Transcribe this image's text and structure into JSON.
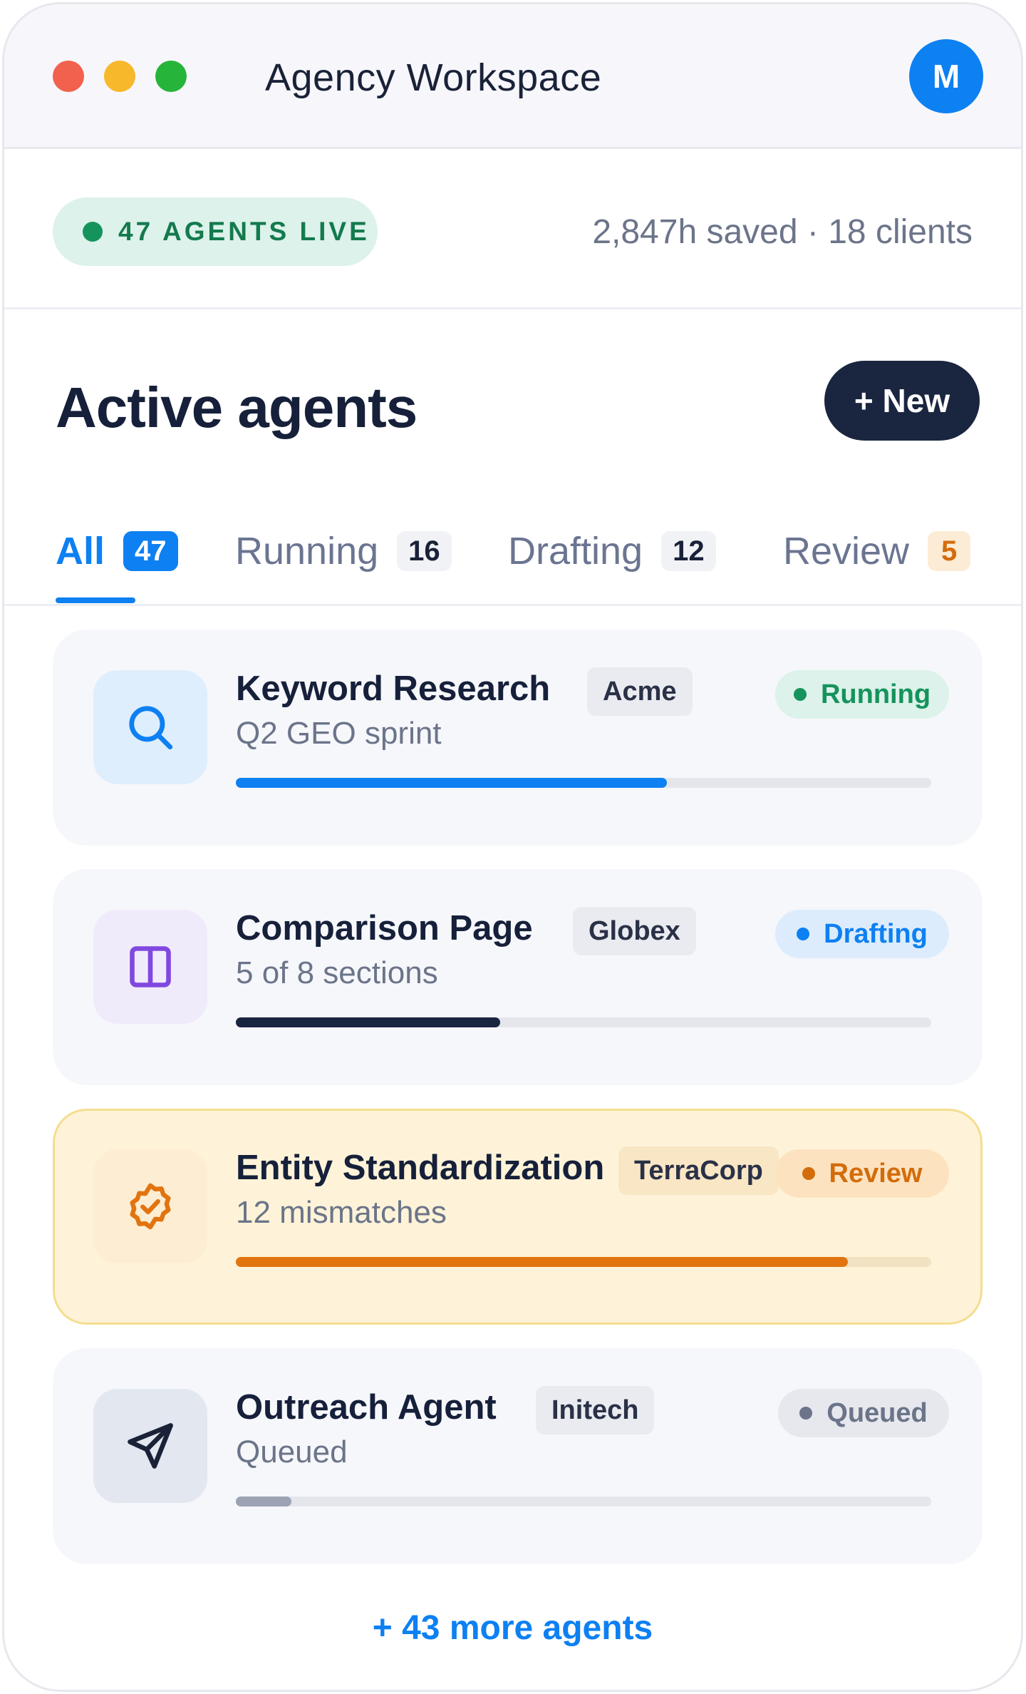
{
  "window": {
    "title": "Agency Workspace",
    "avatar_initial": "M"
  },
  "stats": {
    "live_label": "47 AGENTS LIVE",
    "summary": "2,847h saved · 18 clients"
  },
  "header": {
    "title": "Active agents",
    "new_button": "+ New"
  },
  "tabs": [
    {
      "label": "All",
      "count": "47",
      "active": true
    },
    {
      "label": "Running",
      "count": "16"
    },
    {
      "label": "Drafting",
      "count": "12"
    },
    {
      "label": "Review",
      "count": "5"
    }
  ],
  "agents": [
    {
      "title": "Keyword Research",
      "client": "Acme",
      "subtitle": "Q2 GEO sprint",
      "status": "Running",
      "progress": 0.62,
      "icon": "search-icon"
    },
    {
      "title": "Comparison Page",
      "client": "Globex",
      "subtitle": "5 of 8 sections",
      "status": "Drafting",
      "progress": 0.38,
      "icon": "columns-icon"
    },
    {
      "title": "Entity Standardization",
      "client": "TerraCorp",
      "subtitle": "12 mismatches",
      "status": "Review",
      "progress": 0.88,
      "icon": "badge-check-icon"
    },
    {
      "title": "Outreach Agent",
      "client": "Initech",
      "subtitle": "Queued",
      "status": "Queued",
      "progress": 0.08,
      "icon": "send-icon"
    }
  ],
  "colors": {
    "accent": "#0d80f2",
    "running": "#15935c",
    "drafting": "#0d80f2",
    "review": "#d36c0b",
    "queued": "#6b7489",
    "dark": "#1a2540"
  },
  "footer": {
    "more_link": "+ 43 more agents"
  }
}
